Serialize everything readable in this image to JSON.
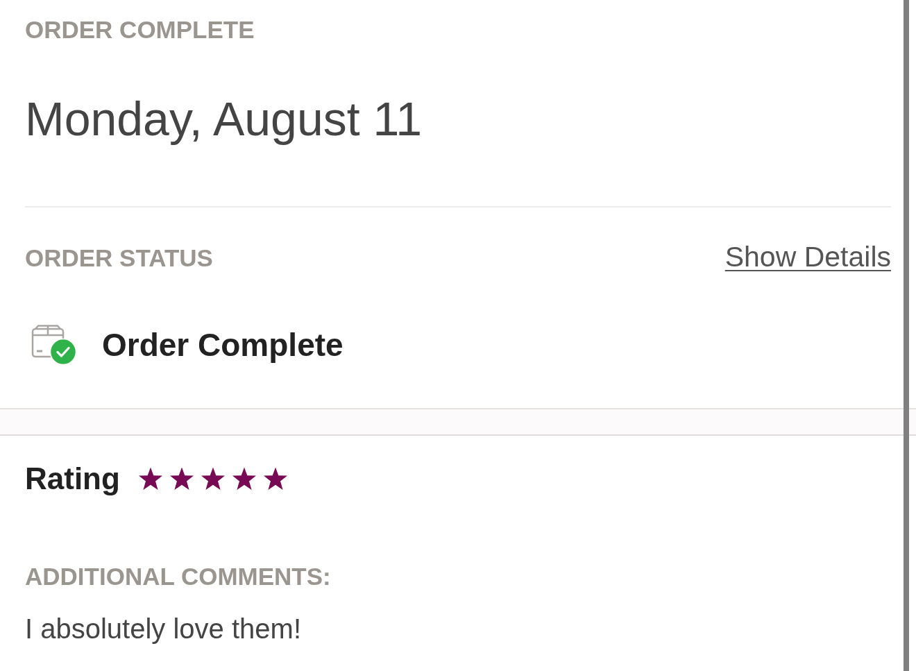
{
  "header": {
    "eyebrow": "ORDER COMPLETE",
    "date": "Monday, August 11"
  },
  "order_status": {
    "label": "ORDER STATUS",
    "link": "Show Details",
    "status": {
      "kind": "complete",
      "text": "Order Complete"
    }
  },
  "rating": {
    "label": "Rating",
    "stars": 5
  },
  "comments": {
    "label": "ADDITIONAL COMMENTS:",
    "text": "I absolutely love them!"
  }
}
